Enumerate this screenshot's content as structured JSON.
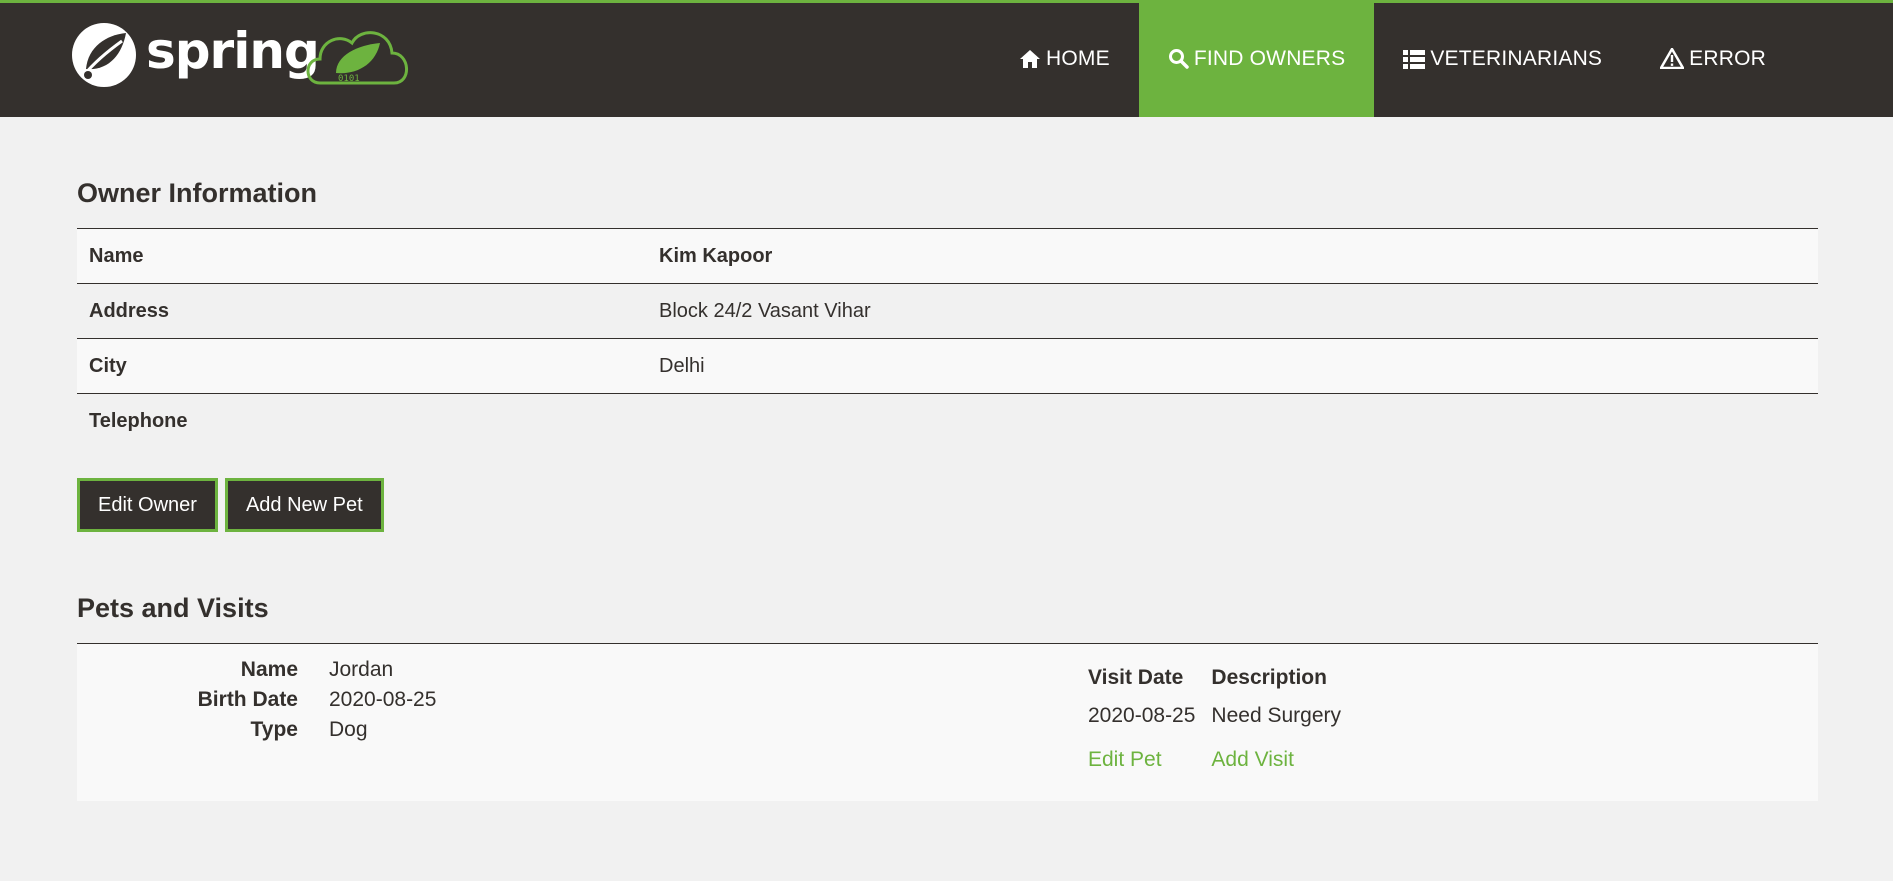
{
  "brand": {
    "logo_text": "spring",
    "colors": {
      "accent": "#6db33f",
      "dark": "#34302d"
    }
  },
  "nav": [
    {
      "label": "Home",
      "icon": "home-icon"
    },
    {
      "label": "Find owners",
      "icon": "search-icon",
      "active": true
    },
    {
      "label": "Veterinarians",
      "icon": "list-icon"
    },
    {
      "label": "Error",
      "icon": "warning-icon"
    }
  ],
  "owner": {
    "heading": "Owner Information",
    "rows": [
      {
        "label": "Name",
        "value": "Kim Kapoor"
      },
      {
        "label": "Address",
        "value": "Block 24/2 Vasant Vihar"
      },
      {
        "label": "City",
        "value": "Delhi"
      },
      {
        "label": "Telephone",
        "value": ""
      }
    ],
    "edit_button": "Edit Owner",
    "add_pet_button": "Add New Pet"
  },
  "pets": {
    "heading": "Pets and Visits",
    "pet": {
      "name_label": "Name",
      "name": "Jordan",
      "birth_label": "Birth Date",
      "birth": "2020-08-25",
      "type_label": "Type",
      "type": "Dog"
    },
    "visits": {
      "col_date": "Visit Date",
      "col_desc": "Description",
      "rows": [
        {
          "date": "2020-08-25",
          "description": "Need Surgery"
        }
      ],
      "edit_pet_link": "Edit Pet",
      "add_visit_link": "Add Visit"
    }
  }
}
